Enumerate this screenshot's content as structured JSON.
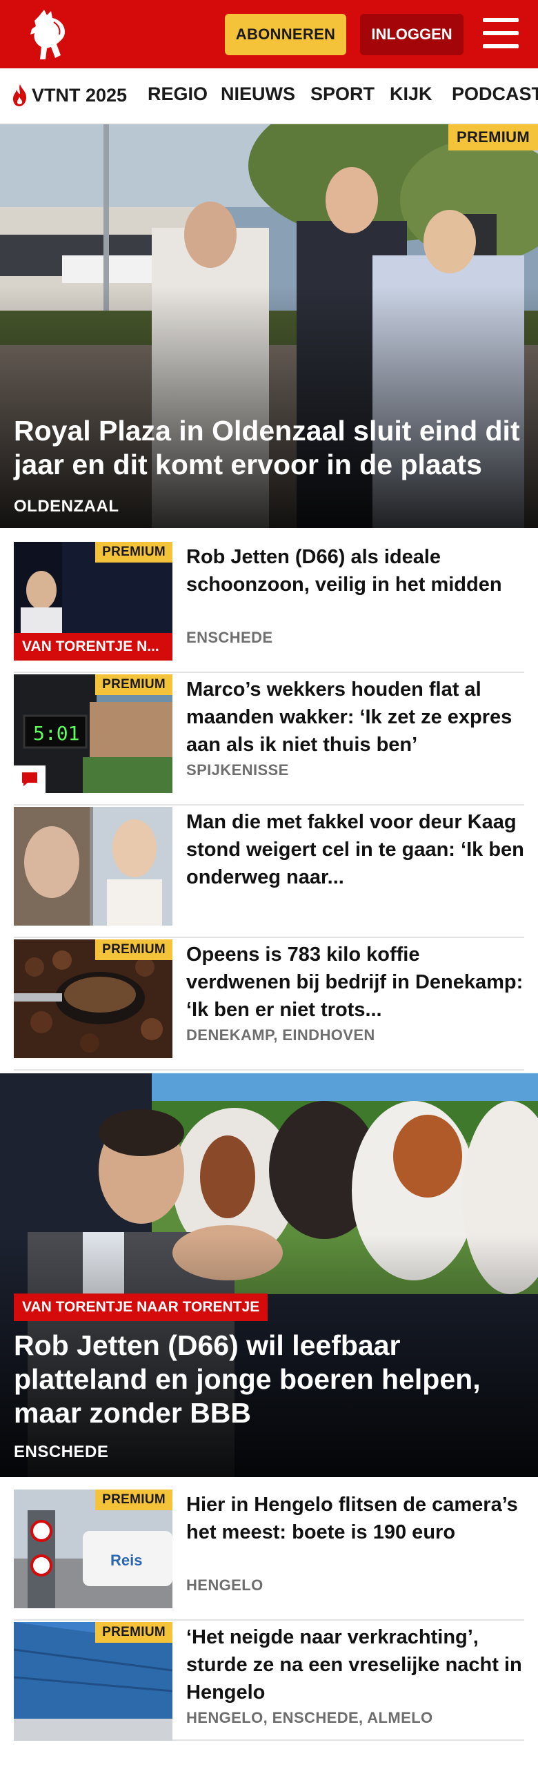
{
  "header": {
    "subscribe_label": "ABONNEREN",
    "login_label": "INLOGGEN",
    "logo_icon": "tubantia-horse-logo",
    "menu_icon": "hamburger-menu-icon"
  },
  "nav": {
    "items": [
      "VTNT 2025",
      "REGIO",
      "NIEUWS",
      "SPORT",
      "KIJK",
      "PODCAST"
    ],
    "flame_icon": "flame-icon"
  },
  "hero1": {
    "badge": "PREMIUM",
    "title": "Royal Plaza in Oldenzaal sluit eind dit jaar en dit komt ervoor in de plaats",
    "location": "OLDENZAAL"
  },
  "articles1": [
    {
      "badge": "PREMIUM",
      "label": "VAN TORENTJE N...",
      "title": "Rob Jetten (D66) als ideale schoonzoon, veilig in het midden",
      "location": "ENSCHEDE"
    },
    {
      "badge": "PREMIUM",
      "title": "Marco’s wekkers houden flat al maanden wakker: ‘Ik zet ze expres aan als ik niet thuis ben’",
      "location": "SPIJKENISSE",
      "comment_icon": "comment-icon"
    },
    {
      "title": "Man die met fakkel voor deur Kaag stond weigert cel in te gaan: ‘Ik ben onderweg naar...",
      "location": ""
    },
    {
      "badge": "PREMIUM",
      "title": "Opeens is 783 kilo koffie verdwenen bij bedrijf in Denekamp: ‘Ik ben er niet trots...",
      "location": "DENEKAMP, EINDHOVEN"
    }
  ],
  "hero2": {
    "label": "VAN TORENTJE NAAR TORENTJE",
    "title": "Rob Jetten (D66) wil leefbaar platteland en jonge boeren helpen, maar zonder BBB",
    "location": "ENSCHEDE"
  },
  "articles2": [
    {
      "badge": "PREMIUM",
      "title": "Hier in Hengelo flitsen de camera’s het meest: boete is 190 euro",
      "location": "HENGELO"
    },
    {
      "badge": "PREMIUM",
      "title": "‘Het neigde naar verkrachting’, sturde ze na een vreselijke nacht in Hengelo",
      "location": "HENGELO, ENSCHEDE, ALMELO"
    }
  ],
  "colors": {
    "brand_red": "#d50a0a",
    "premium_yellow": "#f5c33a",
    "login_dark_red": "#a30508"
  }
}
